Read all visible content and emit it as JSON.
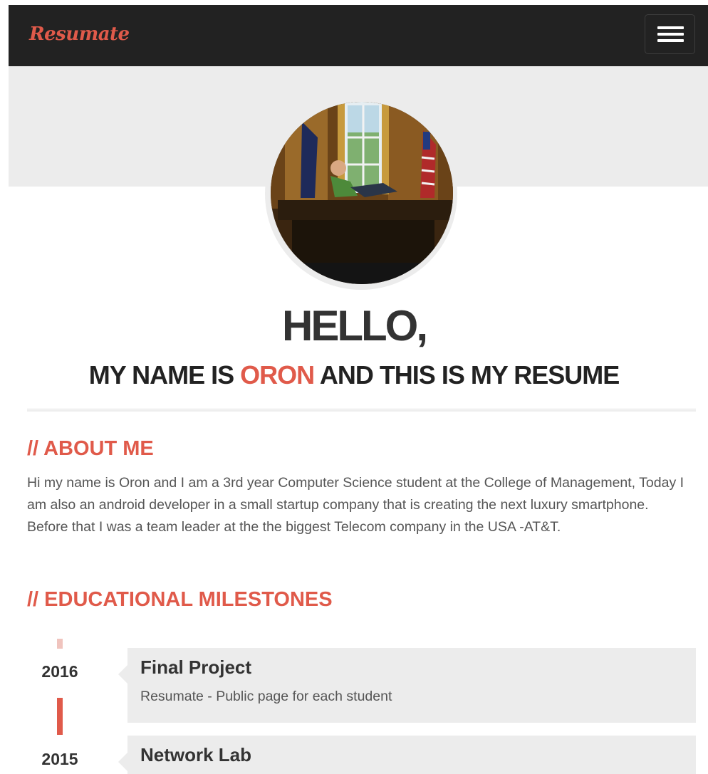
{
  "navbar": {
    "brand": "Resumate",
    "menu_icon": "hamburger-menu-icon",
    "accent_color": "#e05a4a",
    "background_color": "#222222"
  },
  "hero": {
    "avatar_alt": "Profile photo",
    "greeting": "HELLO,",
    "subtitle_prefix": "MY NAME IS ",
    "name": "ORON",
    "subtitle_suffix": " AND THIS IS MY RESUME"
  },
  "about": {
    "title": "// ABOUT ME",
    "text": "Hi my name is Oron and I am a 3rd year Computer Science student at the College of Management, Today I am also an android developer in a small startup company that is creating the next luxury smartphone. Before that I was a team leader at the the biggest Telecom company in the USA -AT&T."
  },
  "education": {
    "title": "// EDUCATIONAL MILESTONES",
    "milestones": [
      {
        "year": "2016",
        "title": "Final Project",
        "description": "Resumate - Public page for each student"
      },
      {
        "year": "2015",
        "title": "Network Lab",
        "description": ""
      }
    ]
  }
}
